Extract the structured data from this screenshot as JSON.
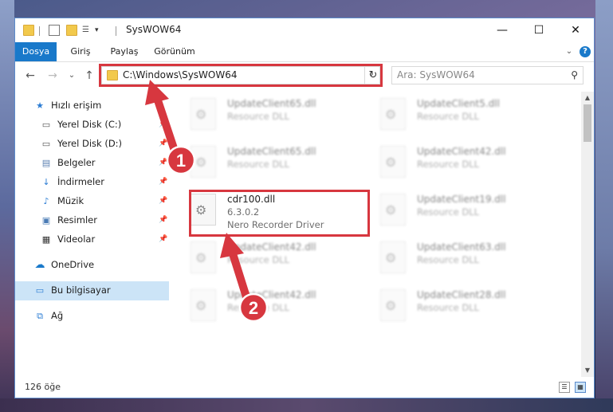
{
  "window": {
    "title": "SysWOW64",
    "minimize": "—",
    "maximize": "☐",
    "close": "✕"
  },
  "ribbon": {
    "tabs": [
      "Dosya",
      "Giriş",
      "Paylaş",
      "Görünüm"
    ],
    "expand": "⌄",
    "help": "?"
  },
  "nav": {
    "back": "←",
    "forward": "→",
    "recent": "⌄",
    "up": "↑",
    "address": "C:\\Windows\\SysWOW64",
    "refresh": "↻",
    "search_placeholder": "Ara: SysWOW64"
  },
  "sidebar": {
    "items": [
      {
        "label": "Hızlı erişim",
        "icon": "star-icon"
      },
      {
        "label": "Yerel Disk (C:)",
        "icon": "drive-icon"
      },
      {
        "label": "Yerel Disk (D:)",
        "icon": "drive-icon"
      },
      {
        "label": "Belgeler",
        "icon": "document-icon"
      },
      {
        "label": "İndirmeler",
        "icon": "download-icon"
      },
      {
        "label": "Müzik",
        "icon": "music-icon"
      },
      {
        "label": "Resimler",
        "icon": "image-icon"
      },
      {
        "label": "Videolar",
        "icon": "video-icon"
      },
      {
        "label": "OneDrive",
        "icon": "cloud-icon"
      },
      {
        "label": "Bu bilgisayar",
        "icon": "computer-icon"
      },
      {
        "label": "Ağ",
        "icon": "network-icon"
      }
    ]
  },
  "files": {
    "left": [
      {
        "name": "UpdateClient65.dll",
        "sub": "Resource DLL"
      },
      {
        "name": "UpdateClient65.dll",
        "sub": "Resource DLL"
      },
      {
        "name": "cdr100.dll",
        "version": "6.3.0.2",
        "description": "Nero Recorder Driver"
      },
      {
        "name": "UpdateClient42.dll",
        "sub": "Resource DLL"
      },
      {
        "name": "UpdateClient42.dll",
        "sub": "Resource DLL"
      }
    ],
    "right": [
      {
        "name": "UpdateClient5.dll",
        "sub": "Resource DLL"
      },
      {
        "name": "UpdateClient42.dll",
        "sub": "Resource DLL"
      },
      {
        "name": "UpdateClient19.dll",
        "sub": "Resource DLL"
      },
      {
        "name": "UpdateClient63.dll",
        "sub": "Resource DLL"
      },
      {
        "name": "UpdateClient28.dll",
        "sub": "Resource DLL"
      }
    ]
  },
  "status": {
    "count": "126 öğe"
  },
  "annotations": {
    "step1": "1",
    "step2": "2",
    "color": "#d7373f"
  }
}
